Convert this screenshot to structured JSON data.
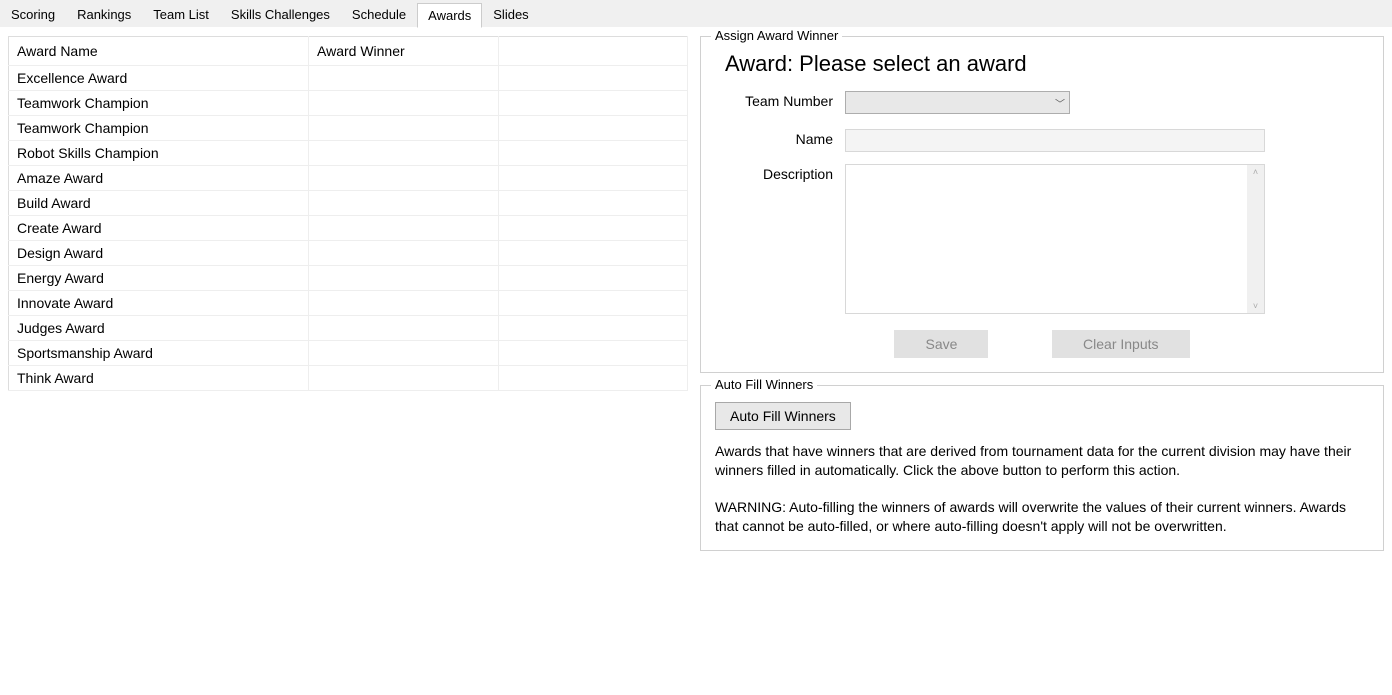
{
  "tabs": [
    {
      "label": "Scoring"
    },
    {
      "label": "Rankings"
    },
    {
      "label": "Team List"
    },
    {
      "label": "Skills Challenges"
    },
    {
      "label": "Schedule"
    },
    {
      "label": "Awards",
      "active": true
    },
    {
      "label": "Slides"
    }
  ],
  "awardsTable": {
    "headers": {
      "name": "Award Name",
      "winner": "Award Winner",
      "extra": ""
    },
    "rows": [
      {
        "name": "Excellence Award",
        "winner": ""
      },
      {
        "name": "Teamwork Champion",
        "winner": ""
      },
      {
        "name": "Teamwork Champion",
        "winner": ""
      },
      {
        "name": "Robot Skills Champion",
        "winner": ""
      },
      {
        "name": "Amaze Award",
        "winner": ""
      },
      {
        "name": "Build Award",
        "winner": ""
      },
      {
        "name": "Create Award",
        "winner": ""
      },
      {
        "name": "Design Award",
        "winner": ""
      },
      {
        "name": "Energy Award",
        "winner": ""
      },
      {
        "name": "Innovate Award",
        "winner": ""
      },
      {
        "name": "Judges Award",
        "winner": ""
      },
      {
        "name": "Sportsmanship Award",
        "winner": ""
      },
      {
        "name": "Think Award",
        "winner": ""
      }
    ]
  },
  "assignPanel": {
    "title": "Assign Award Winner",
    "heading": "Award: Please select an award",
    "labels": {
      "teamNumber": "Team Number",
      "name": "Name",
      "description": "Description"
    },
    "fields": {
      "teamNumber": "",
      "name": "",
      "description": ""
    },
    "buttons": {
      "save": "Save",
      "clear": "Clear Inputs"
    }
  },
  "autoFillPanel": {
    "title": "Auto Fill Winners",
    "button": "Auto Fill Winners",
    "description": "Awards that have winners that are derived from tournament data for the current division may have their winners filled in automatically. Click the above button to perform this action.",
    "warning": "WARNING: Auto-filling the winners of awards will overwrite the values of their current winners. Awards that cannot be auto-filled, or where auto-filling doesn't apply will not be overwritten."
  }
}
